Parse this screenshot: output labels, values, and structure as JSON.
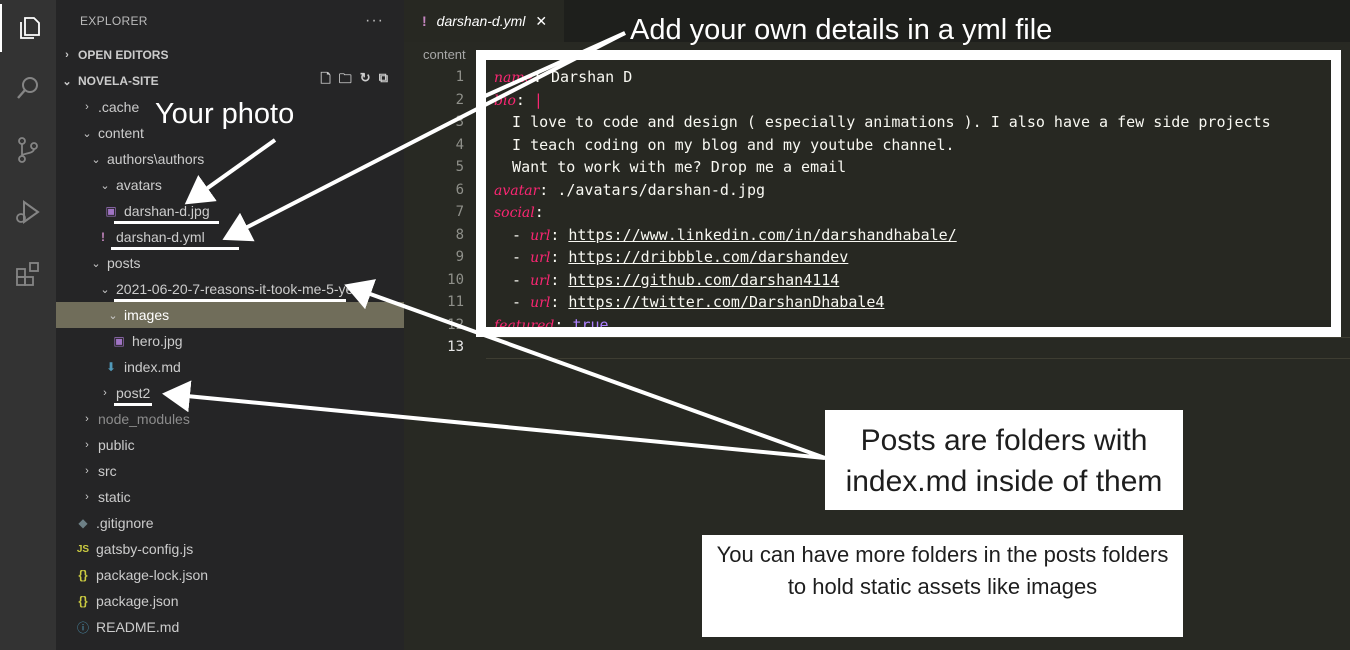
{
  "explorer": {
    "title": "EXPLORER",
    "more": "···",
    "open_editors": "OPEN EDITORS",
    "project": "NOVELA-SITE"
  },
  "tree": [
    {
      "label": ".cache",
      "twisty": "›"
    },
    {
      "label": "content",
      "twisty": "⌄"
    },
    {
      "label": "authors\\authors",
      "twisty": "⌄"
    },
    {
      "label": "avatars",
      "twisty": "⌄"
    },
    {
      "label": "darshan-d.jpg",
      "icon": "▣"
    },
    {
      "label": "darshan-d.yml",
      "icon": "!"
    },
    {
      "label": "posts",
      "twisty": "⌄"
    },
    {
      "label": "2021-06-20-7-reasons-it-took-me-5-yea...",
      "twisty": "⌄"
    },
    {
      "label": "images",
      "twisty": "⌄"
    },
    {
      "label": "hero.jpg",
      "icon": "▣"
    },
    {
      "label": "index.md",
      "icon": "⬇"
    },
    {
      "label": "post2",
      "twisty": "›"
    },
    {
      "label": "node_modules",
      "twisty": "›"
    },
    {
      "label": "public",
      "twisty": "›"
    },
    {
      "label": "src",
      "twisty": "›"
    },
    {
      "label": "static",
      "twisty": "›"
    },
    {
      "label": ".gitignore",
      "icon": "◆"
    },
    {
      "label": "gatsby-config.js",
      "icon": "JS"
    },
    {
      "label": "package-lock.json",
      "icon": "{}"
    },
    {
      "label": "package.json",
      "icon": "{}"
    },
    {
      "label": "README.md",
      "icon": "ⓘ"
    }
  ],
  "tab": {
    "icon": "!",
    "label": "darshan-d.yml",
    "close": "✕"
  },
  "breadcrumb": "content",
  "line_numbers": [
    "1",
    "2",
    "3",
    "4",
    "5",
    "6",
    "7",
    "8",
    "9",
    "10",
    "11",
    "12",
    "13"
  ],
  "code": {
    "l1_key": "name",
    "l1_val": " Darshan D",
    "l2_key": "bio",
    "l2_val": " |",
    "l3": "  I love to code and design ( especially animations ). I also have a few side projects",
    "l4": "  I teach coding on my blog and my youtube channel.",
    "l5": "  Want to work with me? Drop me a email",
    "l6_key": "avatar",
    "l6_val": " ./avatars/darshan-d.jpg",
    "l7_key": "social",
    "url_key": "url",
    "urls": [
      "https://www.linkedin.com/in/darshandhabale/",
      "https://dribbble.com/darshandev",
      "https://github.com/darshan4114",
      "https://twitter.com/DarshanDhabale4"
    ],
    "l12_key": "featured",
    "l12_val": "true"
  },
  "annotations": {
    "yml": "Add your own details in a yml file",
    "photo": "Your photo",
    "posts": "Posts are folders with index.md inside of them",
    "assets": "You can have more folders in the posts folders to hold static assets like images"
  },
  "colors": {
    "keyword": "#f92672",
    "number": "#ae81ff",
    "selection": "#706d5a"
  }
}
